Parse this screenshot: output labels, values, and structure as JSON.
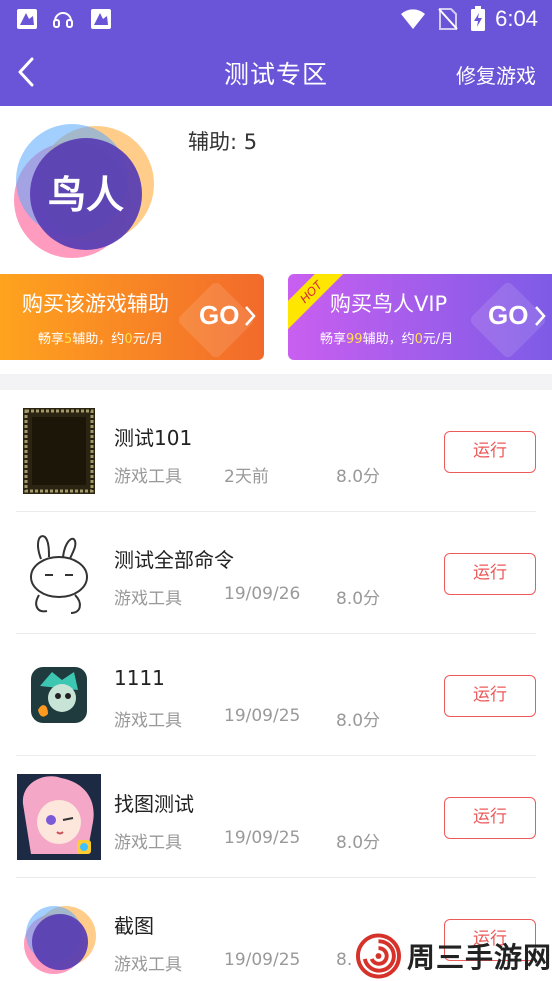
{
  "status_bar": {
    "time": "6:04",
    "left_icons": [
      "app-notification-icon",
      "headset-icon",
      "app-notification-icon"
    ],
    "right_icons": [
      "wifi-icon",
      "no-sim-icon",
      "battery-charging-icon"
    ]
  },
  "nav": {
    "title": "测试专区",
    "action_label": "修复游戏",
    "back_icon": "chevron-left-icon"
  },
  "profile": {
    "logo_text": "鸟人",
    "aux_count": "辅助: 5"
  },
  "banners": {
    "left": {
      "title": "购买该游戏辅助",
      "sub_prefix": "畅享",
      "sub_count": "5",
      "sub_mid": "辅助，约",
      "sub_price": "0",
      "sub_suffix": "元/月",
      "go": "GO"
    },
    "right": {
      "badge": "HOT",
      "title": "购买鸟人VIP",
      "sub_prefix": "畅享",
      "sub_count": "99",
      "sub_mid": "辅助，约",
      "sub_price": "0",
      "sub_suffix": "元/月",
      "go": "GO"
    }
  },
  "games": [
    {
      "name": "测试101",
      "category": "游戏工具",
      "date": "2天前",
      "score": "8.0分",
      "button": "运行",
      "thumb": "dark-frame-icon"
    },
    {
      "name": "测试全部命令",
      "category": "游戏工具",
      "date": "19/09/26",
      "score": "8.0分",
      "button": "运行",
      "thumb": "rabbit-sketch-icon"
    },
    {
      "name": "1111",
      "category": "游戏工具",
      "date": "19/09/25",
      "score": "8.0分",
      "button": "运行",
      "thumb": "game-character-icon"
    },
    {
      "name": "找图测试",
      "category": "游戏工具",
      "date": "19/09/25",
      "score": "8.0分",
      "button": "运行",
      "thumb": "anime-girl-icon"
    },
    {
      "name": "截图",
      "category": "游戏工具",
      "date": "19/09/25",
      "score": "8.",
      "button": "运行",
      "thumb": "app-logo-icon"
    }
  ],
  "watermark": {
    "text": "周三手游网"
  },
  "colors": {
    "header": "#6a55d8",
    "run_button": "#ee5a5a",
    "highlight": "#ffe14a"
  }
}
